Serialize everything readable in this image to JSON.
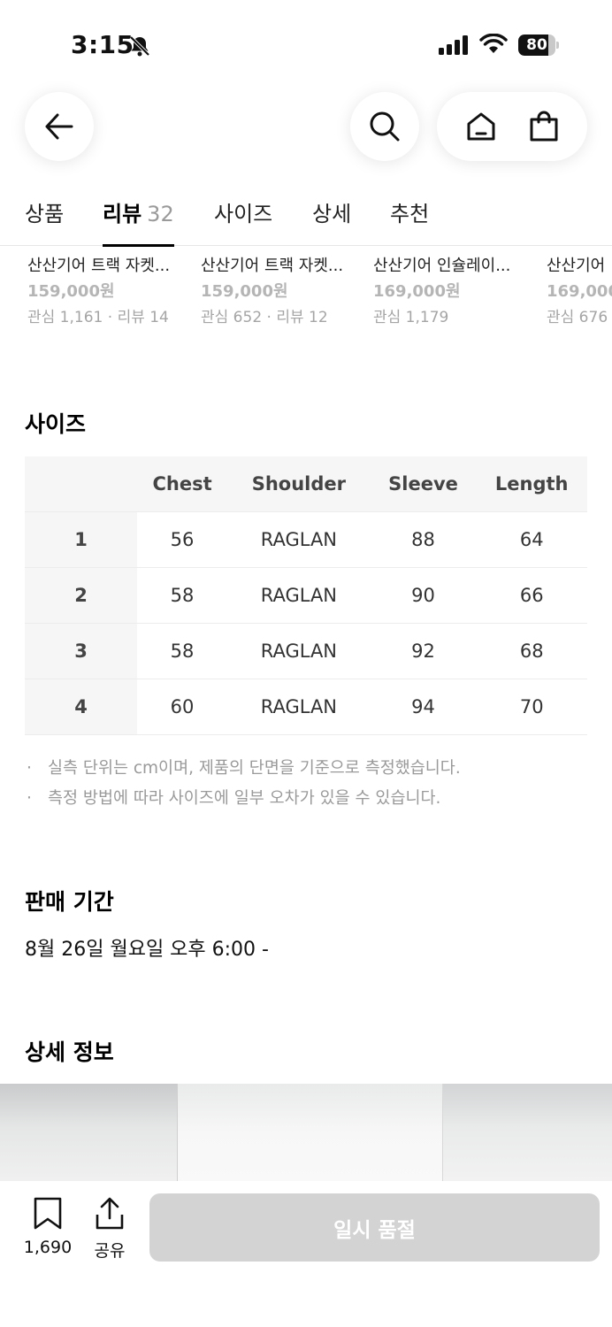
{
  "status_bar": {
    "time": "3:15",
    "battery": "80",
    "battery_level": 0.8
  },
  "nav": {
    "icons": [
      "arrow-left-icon",
      "search-icon",
      "home-icon",
      "shopping-bag-icon"
    ]
  },
  "tabs": {
    "items": [
      {
        "label": "상품"
      },
      {
        "label": "리뷰",
        "count": "32"
      },
      {
        "label": "사이즈"
      },
      {
        "label": "상세"
      },
      {
        "label": "추천"
      }
    ],
    "active_index": 1
  },
  "recommended": {
    "products": [
      {
        "name": "산산기어 트랙 자켓...",
        "price": "159,000원",
        "meta": "관심 1,161 · 리뷰 14"
      },
      {
        "name": "산산기어 트랙 자켓...",
        "price": "159,000원",
        "meta": "관심 652 · 리뷰 12"
      },
      {
        "name": "산산기어 인슐레이...",
        "price": "169,000원",
        "meta": "관심 1,179"
      },
      {
        "name": "산산기어",
        "price": "169,000",
        "meta": "관심 676"
      }
    ]
  },
  "size_section": {
    "title": "사이즈",
    "headers": [
      "Chest",
      "Shoulder",
      "Sleeve",
      "Length"
    ],
    "rows": [
      {
        "size": "1",
        "values": [
          "56",
          "RAGLAN",
          "88",
          "64"
        ]
      },
      {
        "size": "2",
        "values": [
          "58",
          "RAGLAN",
          "90",
          "66"
        ]
      },
      {
        "size": "3",
        "values": [
          "58",
          "RAGLAN",
          "92",
          "68"
        ]
      },
      {
        "size": "4",
        "values": [
          "60",
          "RAGLAN",
          "94",
          "70"
        ]
      }
    ],
    "notes": [
      "실측 단위는 cm이며, 제품의 단면을 기준으로 측정했습니다.",
      "측정 방법에 따라 사이즈에 일부 오차가 있을 수 있습니다."
    ]
  },
  "sale_section": {
    "title": "판매 기간",
    "period": "8월 26일 월요일 오후 6:00 -"
  },
  "detail_section": {
    "title": "상세 정보"
  },
  "bottom_bar": {
    "like_count": "1,690",
    "share_label": "공유",
    "soldout_label": "일시 품절"
  },
  "colors": {
    "accent": "#000000",
    "muted_text": "#9a9a9a",
    "disabled_button": "#d3d3d3"
  }
}
